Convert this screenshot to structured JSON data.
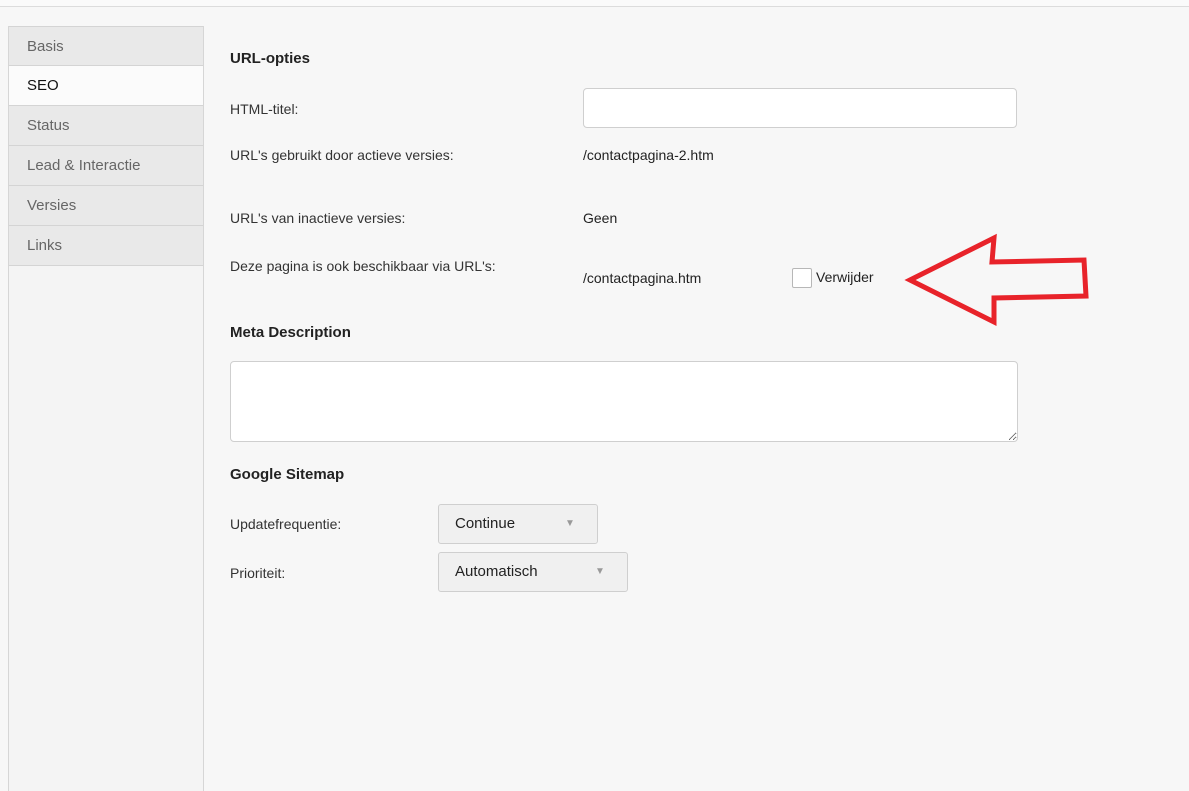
{
  "sidebar": {
    "items": [
      {
        "label": "Basis"
      },
      {
        "label": "SEO"
      },
      {
        "label": "Status"
      },
      {
        "label": "Lead & Interactie"
      },
      {
        "label": "Versies"
      },
      {
        "label": "Links"
      }
    ],
    "active": "SEO"
  },
  "url_options": {
    "heading": "URL-opties",
    "html_title_label": "HTML-titel:",
    "html_title_value": "",
    "active_urls_label": "URL's gebruikt door actieve versies:",
    "active_urls_value": "/contactpagina-2.htm",
    "inactive_urls_label": "URL's van inactieve versies:",
    "inactive_urls_value": "Geen",
    "also_available_label": "Deze pagina is ook beschikbaar via URL's:",
    "also_available_value": "/contactpagina.htm",
    "remove_label": "Verwijder",
    "remove_checked": false
  },
  "meta": {
    "heading": "Meta Description",
    "value": ""
  },
  "sitemap": {
    "heading": "Google Sitemap",
    "frequency_label": "Updatefrequentie:",
    "frequency_value": "Continue",
    "priority_label": "Prioriteit:",
    "priority_value": "Automatisch"
  },
  "annotation": {
    "arrow_color": "#e8232a",
    "arrow_direction": "left"
  }
}
